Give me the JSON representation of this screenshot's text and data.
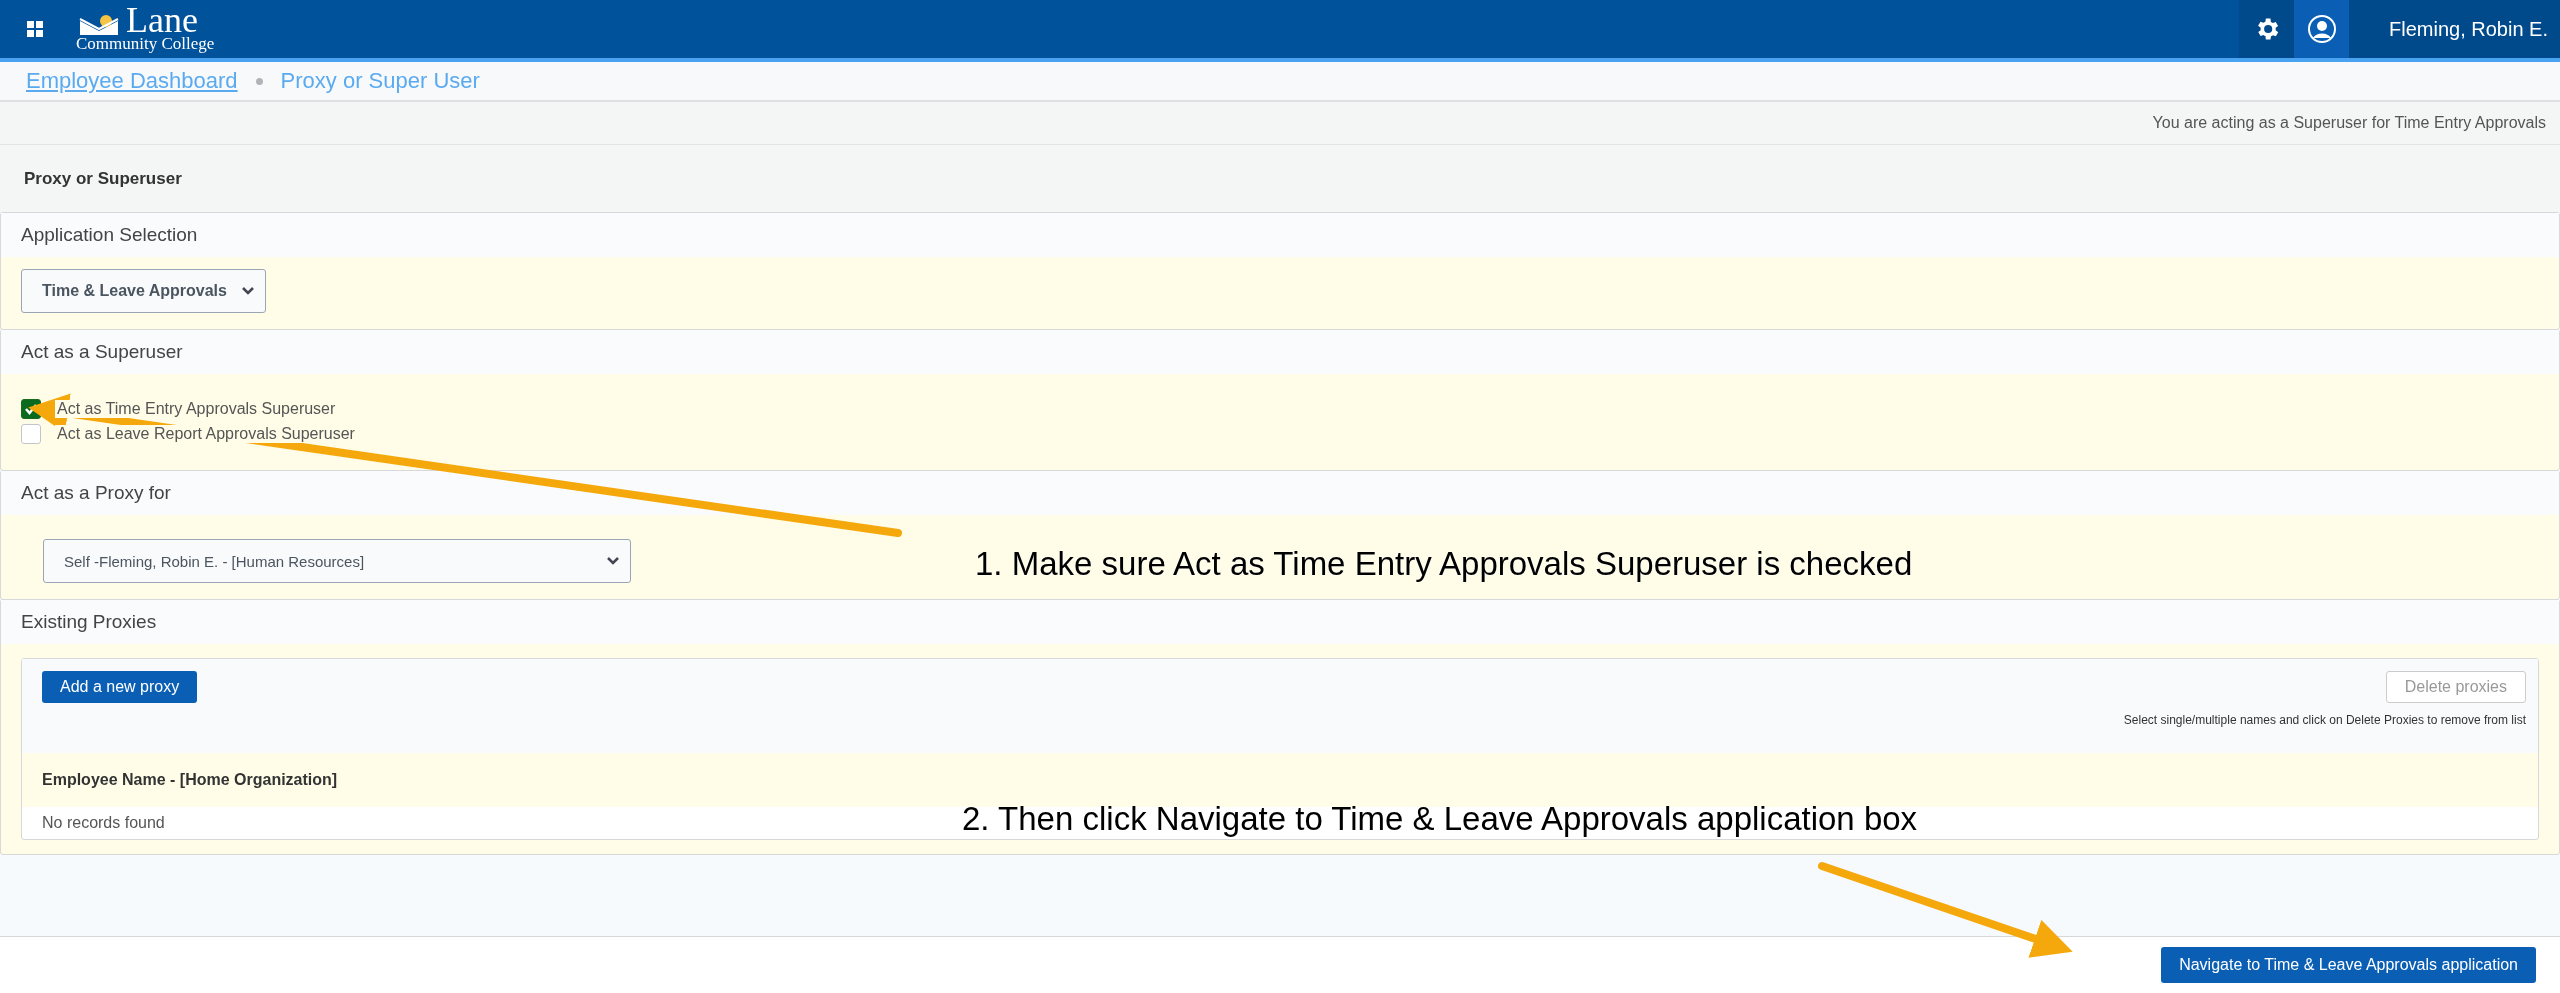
{
  "header": {
    "logo_name": "Lane",
    "logo_subtitle": "Community College",
    "user_name": "Fleming, Robin E."
  },
  "breadcrumbs": [
    {
      "label": "Employee Dashboard",
      "link": true
    },
    {
      "label": "Proxy or Super User",
      "link": false
    }
  ],
  "notice": "You are acting as a Superuser for Time Entry Approvals",
  "page_title": "Proxy or Superuser",
  "sections": [
    {
      "kind": "select",
      "title": "Application Selection",
      "value": "Time & Leave Approvals"
    },
    {
      "kind": "checkboxes",
      "title": "Act as a Superuser",
      "options": [
        {
          "label": "Act as Time Entry Approvals Superuser",
          "checked": true
        },
        {
          "label": "Act as Leave Report Approvals Superuser",
          "checked": false
        }
      ]
    },
    {
      "kind": "select",
      "title": "Act as a Proxy for",
      "value": "Self -Fleming, Robin E. - [Human Resources]"
    },
    {
      "kind": "proxies",
      "title": "Existing Proxies",
      "add_button": "Add a new proxy",
      "delete_button": {
        "label": "Delete proxies",
        "disabled": true
      },
      "hint": "Select single/multiple names and click on Delete Proxies to remove from list",
      "column": "Employee Name - [Home Organization]",
      "empty_text": "No records found"
    }
  ],
  "footer_button": "Navigate to Time & Leave Approvals application",
  "annotations": [
    "1. Make sure Act as Time Entry Approvals Superuser is checked",
    "2. Then click Navigate to Time & Leave Approvals application box"
  ]
}
